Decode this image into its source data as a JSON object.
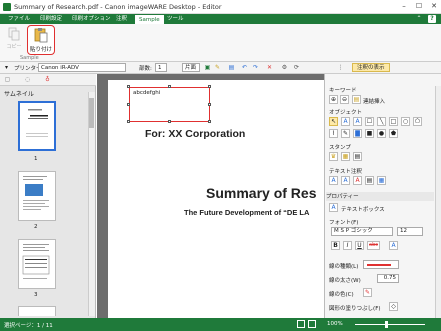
{
  "window": {
    "title": "Summary of Research.pdf - Canon imageWARE Desktop - Editor",
    "minimize": "–",
    "maximize": "☐",
    "close": "✕"
  },
  "menu": {
    "tabs": [
      "ファイル",
      "印刷設定",
      "印刷オプション",
      "注釈",
      "Sample",
      "ツール"
    ],
    "active_tab": "Sample",
    "right_buttons": [
      "⌃",
      "?"
    ]
  },
  "ribbon": {
    "copy_label": "コピー",
    "paste_label": "貼り付け",
    "group_label": "Sample"
  },
  "toolbar": {
    "printer_label": "プリンター:",
    "printer_value": "Canon iR-ADV",
    "copies_label": "部数:",
    "copies_value": "1",
    "duplex_value": "片面",
    "annotations_toggle": "注釈の表示"
  },
  "left_panel": {
    "title": "サムネイル",
    "pages": [
      "1",
      "2",
      "3"
    ],
    "selected_page": "1"
  },
  "document": {
    "textbox_text": "abcdefghi",
    "for_line": "For: XX Corporation",
    "summary_line": "Summary of Res",
    "future_line": "The Future Development of “DE LA"
  },
  "right_panel": {
    "keyword_label": "キーワード",
    "text_insert_label": "連結挿入",
    "object_label": "オブジェクト",
    "stamp_label": "スタンプ",
    "text_annotation_label": "テキスト注釈",
    "property_label": "プロパティー",
    "textbox_prop": "テキストボックス",
    "font_label": "フォント(F)",
    "font_value": "M S P ゴシック",
    "font_size": "12",
    "line_type_label": "線の種類(L)",
    "line_width_label": "線の太さ(W)",
    "line_width_value": "0.75",
    "line_color_label": "線の色(C)",
    "shape_fill_label": "図形の塗りつぶし(F)"
  },
  "status": {
    "page_text": "選択ページ：1 / 11",
    "zoom": "100%"
  }
}
